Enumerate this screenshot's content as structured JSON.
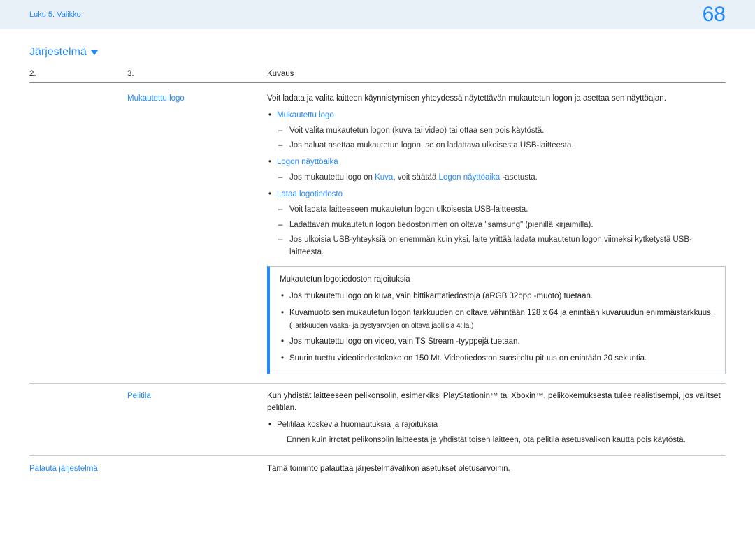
{
  "header": {
    "breadcrumb": "Luku 5. Valikko",
    "page_number": "68"
  },
  "section": {
    "title": "Järjestelmä"
  },
  "table": {
    "headers": {
      "col1": "2.",
      "col2": "3.",
      "col3": "Kuvaus"
    },
    "rows": [
      {
        "col1": "",
        "col2": "Mukautettu logo",
        "col3": {
          "intro": "Voit ladata ja valita laitteen käynnistymisen yhteydessä näytettävän mukautetun logon ja asettaa sen näyttöajan.",
          "items": [
            {
              "title": "Mukautettu logo",
              "lines": [
                "Voit valita mukautetun logon (kuva tai video) tai ottaa sen pois käytöstä.",
                "Jos haluat asettaa mukautetun logon, se on ladattava ulkoisesta USB-laitteesta."
              ]
            },
            {
              "title": "Logon näyttöaika",
              "lines_rich": {
                "prefix": "Jos mukautettu logo on ",
                "kw1": "Kuva",
                "mid": ", voit säätää ",
                "kw2": "Logon näyttöaika",
                "suffix": " -asetusta."
              }
            },
            {
              "title": "Lataa logotiedosto",
              "lines": [
                "Voit ladata laitteeseen mukautetun logon ulkoisesta USB-laitteesta.",
                "Ladattavan mukautetun logon tiedostonimen on oltava \"samsung\" (pienillä kirjaimilla).",
                "Jos ulkoisia USB-yhteyksiä on enemmän kuin yksi, laite yrittää ladata mukautetun logon viimeksi kytketystä USB-laitteesta."
              ]
            }
          ],
          "callout": {
            "title": "Mukautetun logotiedoston rajoituksia",
            "bullets": [
              "Jos mukautettu logo on kuva, vain bittikarttatiedostoja (aRGB 32bpp -muoto) tuetaan.",
              "Kuvamuotoisen mukautetun logon tarkkuuden on oltava vähintään 128 x 64 ja enintään kuvaruudun enimmäistarkkuus.",
              "Jos mukautettu logo on video, vain TS Stream -tyyppejä tuetaan.",
              "Suurin tuettu videotiedostokoko on 150 Mt. Videotiedoston suositeltu pituus on enintään 20 sekuntia."
            ],
            "bullet1_note": "(Tarkkuuden vaaka- ja pystyarvojen on oltava jaollisia 4:llä.)"
          }
        }
      },
      {
        "col1": "",
        "col2": "Pelitila",
        "col3": {
          "intro": "Kun yhdistät laitteeseen pelikonsolin, esimerkiksi PlayStationin™ tai Xboxin™, pelikokemuksesta tulee realistisempi, jos valitset pelitilan.",
          "bullet_title": "Pelitilaa koskevia huomautuksia ja rajoituksia",
          "bullet_line": "Ennen kuin irrotat pelikonsolin laitteesta ja yhdistät toisen laitteen, ota pelitila asetusvalikon kautta pois käytöstä."
        }
      },
      {
        "col1": "Palauta järjestelmä",
        "col2": "",
        "col3": {
          "intro": "Tämä toiminto palauttaa järjestelmävalikon asetukset oletusarvoihin."
        }
      }
    ]
  }
}
